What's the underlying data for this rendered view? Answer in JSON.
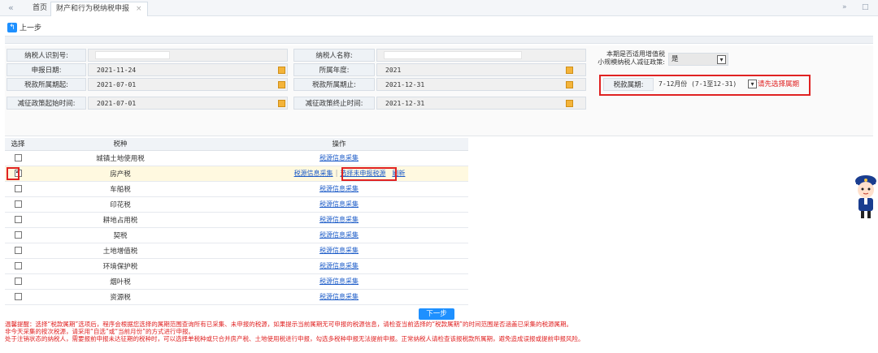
{
  "topbar": {
    "collapse_icon": "double-left-arrow",
    "tabs": [
      {
        "label": "首页"
      },
      {
        "label": "财产和行为税纳税申报"
      }
    ],
    "tab_close": "×",
    "right_icons": [
      "»",
      "□"
    ]
  },
  "back": {
    "label": "上一步"
  },
  "form": {
    "taxpayer_id_label": "纳税人识别号:",
    "taxpayer_name_label": "纳税人名称:",
    "declare_date_label": "申报日期:",
    "declare_date": "2021-11-24",
    "year_label": "所属年度:",
    "year": "2021",
    "period_start_label": "税款所属期起:",
    "period_start": "2021-07-01",
    "period_end_label": "税款所属期止:",
    "period_end": "2021-12-31",
    "policy_start_label": "减征政策起始时间:",
    "policy_start": "2021-07-01",
    "policy_end_label": "减征政策终止时间:",
    "policy_end": "2021-12-31",
    "small_scale_label_1": "本期是否适用增值税",
    "small_scale_label_2": "小规模纳税人减征政策:",
    "small_scale_value": "是",
    "tax_period_label": "税款属期:",
    "tax_period_value": "7-12月份 (7-1至12-31)",
    "tax_period_hint": "请先选择属期"
  },
  "grid": {
    "headers": [
      "选择",
      "税种",
      "操作"
    ],
    "rows": [
      {
        "name": "城镇土地使用税",
        "checked": false,
        "ops": [
          "税源信息采集"
        ]
      },
      {
        "name": "房产税",
        "checked": true,
        "ops": [
          "税源信息采集",
          "选择未申报税源",
          "刷新"
        ]
      },
      {
        "name": "车船税",
        "checked": false,
        "ops": [
          "税源信息采集"
        ]
      },
      {
        "name": "印花税",
        "checked": false,
        "ops": [
          "税源信息采集"
        ]
      },
      {
        "name": "耕地占用税",
        "checked": false,
        "ops": [
          "税源信息采集"
        ]
      },
      {
        "name": "契税",
        "checked": false,
        "ops": [
          "税源信息采集"
        ]
      },
      {
        "name": "土地增值税",
        "checked": false,
        "ops": [
          "税源信息采集"
        ]
      },
      {
        "name": "环境保护税",
        "checked": false,
        "ops": [
          "税源信息采集"
        ]
      },
      {
        "name": "烟叶税",
        "checked": false,
        "ops": [
          "税源信息采集"
        ]
      },
      {
        "name": "资源税",
        "checked": false,
        "ops": [
          "税源信息采集"
        ]
      }
    ]
  },
  "next": {
    "label": "下一步"
  },
  "notes": [
    "温馨提醒：选择“税款属期”选项后，程序会根据您选择的属期范围查询所有已采集、未申报的税源，如果提示当前属期无可申报的税源信息，请检查当前选择的“税款属期”的时间范围是否涵盖已采集的税源属期。",
    "非今天采集的按次税源，请采用“自选”或“当前月份”的方式进行申报。",
    "处于注销状态的纳税人，需要报前申报未达征期的税种时，可以选择单税种或只合并房产税、土地使用税进行申报，勾选多税种申报无法提前申报。正常纳税人请检查该报税款所属期，避免造成误报或提前申报风险。"
  ],
  "colors": {
    "accent": "#1e90ff",
    "alert": "#e02222",
    "link": "#1d5cc8"
  }
}
